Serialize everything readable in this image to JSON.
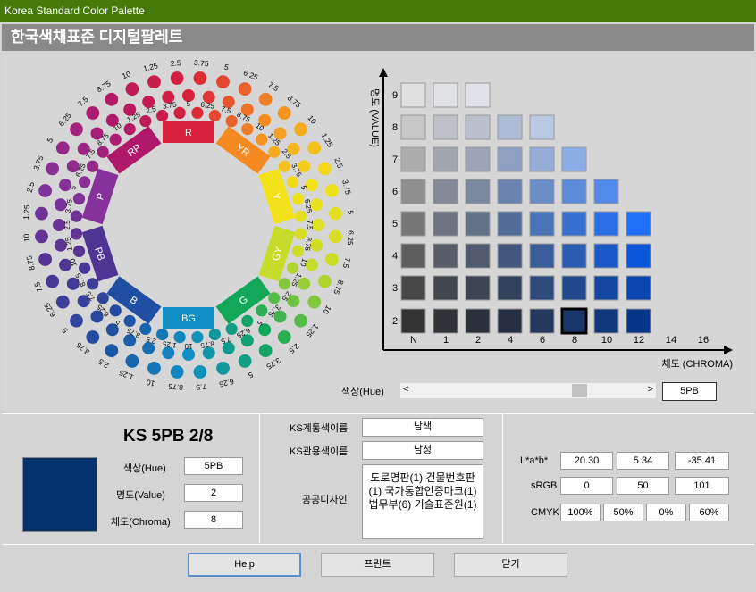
{
  "window": {
    "title": "Korea Standard Color Palette"
  },
  "header": {
    "title": "한국색채표준 디지털팔레트"
  },
  "wheel": {
    "hue_labels": [
      "R",
      "YR",
      "Y",
      "GY",
      "G",
      "BG",
      "B",
      "PB",
      "P",
      "RP"
    ],
    "hue_colors": [
      "#d8203a",
      "#f58a22",
      "#f3e21a",
      "#c6dc2a",
      "#13a75a",
      "#0f8fc4",
      "#1f4ea2",
      "#4e3493",
      "#86329a",
      "#b0186a"
    ],
    "step_labels": [
      "1.25",
      "2.5",
      "3.75",
      "5",
      "6.25",
      "7.5",
      "8.75",
      "10"
    ]
  },
  "chart": {
    "y_axis_label": "명도 (VALUE)",
    "x_axis_label": "채도 (CHROMA)",
    "y_ticks": [
      "9",
      "8",
      "7",
      "6",
      "5",
      "4",
      "3",
      "2"
    ],
    "x_ticks": [
      "N",
      "1",
      "2",
      "4",
      "6",
      "8",
      "10",
      "12",
      "14",
      "16"
    ],
    "selected": {
      "value": 2,
      "chroma": 8
    }
  },
  "hue_slider": {
    "label": "색상(Hue)",
    "value": "5PB"
  },
  "info": {
    "code": "KS 5PB 2/8",
    "swatch_color": "#05326a",
    "hue_label": "색상(Hue)",
    "hue_value": "5PB",
    "value_label": "명도(Value)",
    "value_value": "2",
    "chroma_label": "채도(Chroma)",
    "chroma_value": "8"
  },
  "names": {
    "system_label": "KS계통색이름",
    "system_value": "남색",
    "common_label": "KS관용색이름",
    "common_value": "남청",
    "public_label": "공공디자인",
    "public_value": "도로명판(1) 건물번호판(1) 국가통합인증마크(1) 법무부(6) 기술표준원(1)"
  },
  "values": {
    "lab_label": "L*a*b*",
    "lab": [
      "20.30",
      "5.34",
      "-35.41"
    ],
    "srgb_label": "sRGB",
    "srgb": [
      "0",
      "50",
      "101"
    ],
    "cmyk_label": "CMYK",
    "cmyk": [
      "100%",
      "50%",
      "0%",
      "60%"
    ]
  },
  "buttons": {
    "help": "Help",
    "print": "프린트",
    "close": "닫기"
  }
}
